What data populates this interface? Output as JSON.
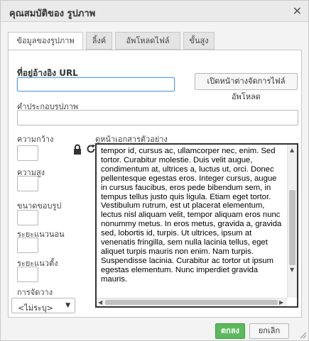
{
  "dialog": {
    "title": "คุณสมบัติของ รูปภาพ",
    "close_glyph": "✕"
  },
  "tabs": [
    {
      "label": "ข้อมูลของรูปภาพ",
      "active": true
    },
    {
      "label": "ลิ้งค์",
      "active": false
    },
    {
      "label": "อัพโหลดไฟล์",
      "active": false
    },
    {
      "label": "ขั้นสูง",
      "active": false
    }
  ],
  "url": {
    "label": "ที่อยู่อ้างอิง URL",
    "value": "",
    "browse_label": "เปิดหน้าต่างจัดการไฟล์อัพโหลด"
  },
  "alt": {
    "label": "คำประกอบรูปภาพ",
    "value": ""
  },
  "dimensions": {
    "width_label": "ความกว้าง",
    "width_value": "",
    "height_label": "ความสูง",
    "height_value": "",
    "lock_icon": "lock-icon",
    "reset_icon": "reset-size-icon"
  },
  "border": {
    "label": "ขนาดขอบรูป",
    "value": ""
  },
  "hspace": {
    "label": "ระยะแนวนอน",
    "value": ""
  },
  "vspace": {
    "label": "ระยะแนวตั้ง",
    "value": ""
  },
  "align": {
    "label": "การจัดวาง",
    "selected": "<ไม่ระบุ>"
  },
  "preview": {
    "label": "ดูหน้าเอกสารตัวอย่าง",
    "text": "tempor id, cursus ac, ullamcorper nec, enim. Sed tortor. Curabitur molestie. Duis velit augue, condimentum at, ultrices a, luctus ut, orci. Donec pellentesque egestas eros. Integer cursus, augue in cursus faucibus, eros pede bibendum sem, in tempus tellus justo quis ligula. Etiam eget tortor. Vestibulum rutrum, est ut placerat elementum, lectus nisl aliquam velit, tempor aliquam eros nunc nonummy metus. In eros metus, gravida a, gravida sed, lobortis id, turpis. Ut ultrices, ipsum at venenatis fringilla, sem nulla lacinia tellus, eget aliquet turpis mauris non enim. Nam turpis. Suspendisse lacinia. Curabitur ac tortor ut ipsum egestas elementum. Nunc imperdiet gravida mauris."
  },
  "footer": {
    "ok_label": "ตกลง",
    "cancel_label": "ยกเลิก"
  },
  "colors": {
    "ok_button": "#5cb85c",
    "focus_border": "#59a0dc",
    "dialog_bg": "#f3f3f3",
    "titlebar_bg": "#eaeaea"
  }
}
